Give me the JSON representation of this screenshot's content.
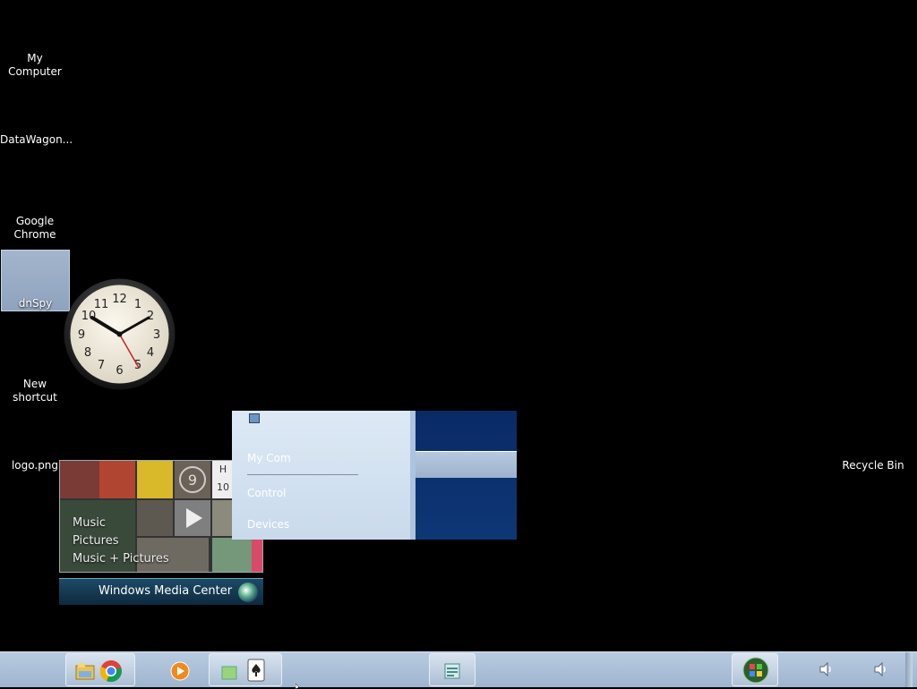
{
  "desktop": {
    "icons": [
      {
        "label": "My Computer"
      },
      {
        "label": "DataWagon..."
      },
      {
        "label": "Google Chrome"
      },
      {
        "label": "dnSpy"
      },
      {
        "label": "New shortcut"
      },
      {
        "label": "logo.png"
      },
      {
        "label": "Recycle Bin"
      }
    ]
  },
  "clock_gadget": {
    "numbers": [
      "12",
      "1",
      "2",
      "3",
      "4",
      "5",
      "6",
      "7",
      "8",
      "9",
      "10",
      "11"
    ]
  },
  "media_center": {
    "menu": [
      "Music",
      "Pictures",
      "Music + Pictures"
    ],
    "bar_label": "Windows Media Center",
    "tile_label": "H",
    "tile_number": "10"
  },
  "jump_list": {
    "items": [
      "My Com",
      "Control",
      "Devices"
    ]
  },
  "taskbar": {
    "accent": "#a9bfd8",
    "buttons": [
      {
        "icon": "file-explorer-icon"
      },
      {
        "icon": "chrome-icon"
      },
      {
        "icon": "media-player-icon"
      },
      {
        "icon": "solitaire-icon"
      },
      {
        "icon": "remote-desktop-icon"
      }
    ],
    "start": {
      "icon": "windows-start-icon"
    }
  }
}
